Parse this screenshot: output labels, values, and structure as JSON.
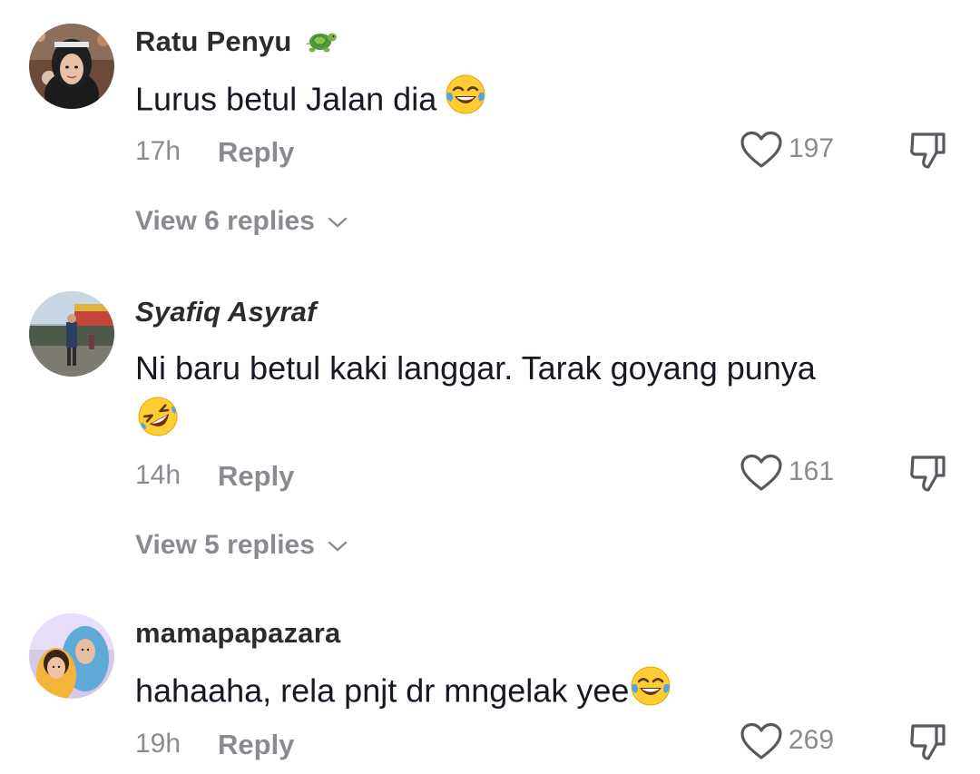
{
  "colors": {
    "text_primary": "#161823",
    "text_secondary": "#8a8b91",
    "background": "#ffffff"
  },
  "comments": [
    {
      "username": "Ratu Penyu",
      "username_emoji": "turtle-emoji",
      "text": "Lurus betul Jalan dia",
      "text_emoji": "tears-of-joy-emoji",
      "time": "17h",
      "reply_label": "Reply",
      "likes": "197",
      "view_replies": "View 6 replies"
    },
    {
      "username": "Syafiq Asyraf",
      "text_line1": "Ni baru betul kaki langgar. Tarak goyang punya",
      "text_emoji": "rolling-on-floor-laughing-emoji",
      "time": "14h",
      "reply_label": "Reply",
      "likes": "161",
      "view_replies": "View 5 replies"
    },
    {
      "username": "mamapapazara",
      "text": "hahaaha, rela pnjt dr mngelak yee",
      "text_emoji": "tears-of-joy-emoji",
      "time": "19h",
      "reply_label": "Reply",
      "likes": "269"
    }
  ]
}
